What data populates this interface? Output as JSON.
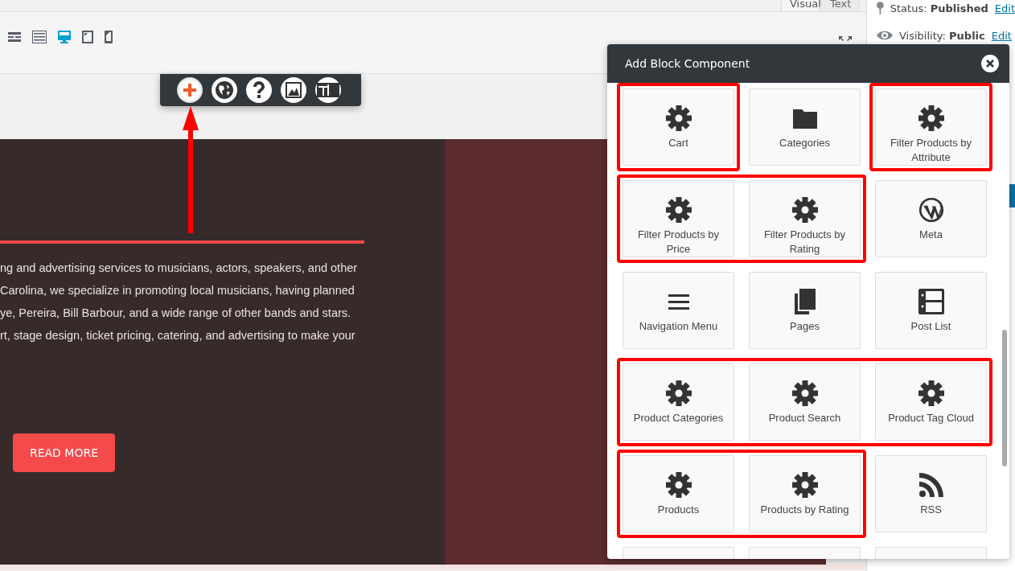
{
  "editor_tabs": [
    {
      "label": "Visual",
      "selected": true
    },
    {
      "label": "Text",
      "selected": false
    }
  ],
  "device_buttons": [
    {
      "kind": "rows",
      "selected": false
    },
    {
      "kind": "keyboard",
      "selected": false
    },
    {
      "kind": "desktop",
      "selected": true
    },
    {
      "kind": "tablet",
      "selected": false
    },
    {
      "kind": "phone",
      "selected": false
    }
  ],
  "floating_toolbar": [
    {
      "kind": "plus",
      "selected": true
    },
    {
      "kind": "globe",
      "selected": false
    },
    {
      "kind": "help",
      "selected": false
    },
    {
      "kind": "image",
      "selected": false
    },
    {
      "kind": "layout",
      "selected": false
    }
  ],
  "hero": {
    "lines": [
      "ng and advertising services to musicians, actors, speakers, and other",
      "Carolina, we specialize in promoting local musicians, having planned",
      "ye, Pereira, Bill Barbour, and a wide range of other bands and stars.",
      "rt, stage design, ticket pricing, catering, and advertising to make your"
    ],
    "button": "READ MORE"
  },
  "publish": [
    {
      "kind": "status",
      "label": "Status:",
      "value": "Published",
      "link": "Edit"
    },
    {
      "kind": "visibility",
      "label": "Visibility:",
      "value": "Public",
      "link": "Edit"
    }
  ],
  "modal": {
    "title": "Add Block Component",
    "tiles": [
      {
        "label": "Cart",
        "kind": "gear",
        "highlighted": true
      },
      {
        "label": "Categories",
        "kind": "folder",
        "highlighted": false
      },
      {
        "label": "Filter Products by Attribute",
        "kind": "gear",
        "highlighted": true
      },
      {
        "label": "Filter Products by Price",
        "kind": "gear",
        "highlighted": true
      },
      {
        "label": "Filter Products by Rating",
        "kind": "gear",
        "highlighted": true
      },
      {
        "label": "Meta",
        "kind": "wordpress",
        "highlighted": false
      },
      {
        "label": "Navigation Menu",
        "kind": "menu",
        "highlighted": false
      },
      {
        "label": "Pages",
        "kind": "pages",
        "highlighted": false
      },
      {
        "label": "Post List",
        "kind": "postlist",
        "highlighted": false
      },
      {
        "label": "Product Categories",
        "kind": "gear",
        "highlighted": true
      },
      {
        "label": "Product Search",
        "kind": "gear",
        "highlighted": true
      },
      {
        "label": "Product Tag Cloud",
        "kind": "gear",
        "highlighted": true
      },
      {
        "label": "Products",
        "kind": "gear",
        "highlighted": true
      },
      {
        "label": "Products by Rating",
        "kind": "gear",
        "highlighted": true
      },
      {
        "label": "RSS",
        "kind": "rss",
        "highlighted": false
      }
    ]
  }
}
